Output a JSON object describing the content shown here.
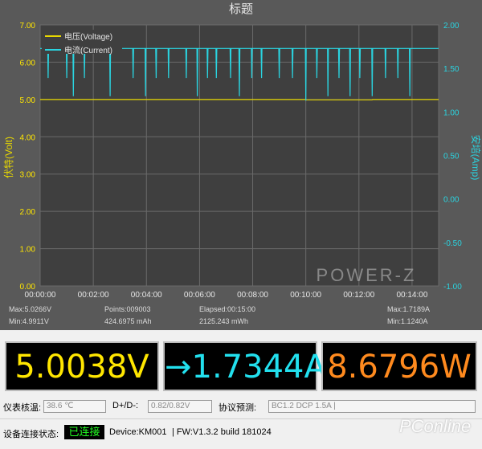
{
  "title": "标题",
  "chart_data": {
    "type": "line",
    "title": "标题",
    "xlabel": "",
    "ylabel_left": "伏特(Volt)",
    "ylabel_right": "安培(Amp)",
    "x_ticks": [
      "00:00:00",
      "00:02:00",
      "00:04:00",
      "00:06:00",
      "00:08:00",
      "00:10:00",
      "00:12:00",
      "00:14:00"
    ],
    "y_left_ticks": [
      "0.00",
      "1.00",
      "2.00",
      "3.00",
      "4.00",
      "5.00",
      "6.00",
      "7.00"
    ],
    "y_right_ticks": [
      "-1.00",
      "-0.50",
      "0.00",
      "0.50",
      "1.00",
      "1.50",
      "2.00"
    ],
    "xlim": [
      0,
      900
    ],
    "ylim_left": [
      0,
      7
    ],
    "ylim_right": [
      -1,
      2
    ],
    "grid": true,
    "legend_position": "top-left",
    "series": [
      {
        "name": "电压(Voltage)",
        "axis": "left",
        "color": "#e8d800",
        "x": [
          0,
          600,
          601,
          750,
          751,
          900
        ],
        "values": [
          5.0,
          5.0,
          4.99,
          4.99,
          5.0,
          5.0
        ]
      },
      {
        "name": "电流(Current)",
        "axis": "right",
        "color": "#2ad4e0",
        "baseline": 1.73,
        "x": [
          0,
          900
        ],
        "values": [
          1.73,
          1.73
        ],
        "dips": [
          {
            "t": 18,
            "v": 1.39
          },
          {
            "t": 60,
            "v": 1.39
          },
          {
            "t": 75,
            "v": 1.18
          },
          {
            "t": 100,
            "v": 1.39
          },
          {
            "t": 158,
            "v": 1.18
          },
          {
            "t": 210,
            "v": 1.39
          },
          {
            "t": 238,
            "v": 1.18
          },
          {
            "t": 262,
            "v": 1.39
          },
          {
            "t": 290,
            "v": 1.39
          },
          {
            "t": 330,
            "v": 1.39
          },
          {
            "t": 355,
            "v": 1.18
          },
          {
            "t": 378,
            "v": 1.39
          },
          {
            "t": 398,
            "v": 1.39
          },
          {
            "t": 430,
            "v": 1.39
          },
          {
            "t": 450,
            "v": 1.18
          },
          {
            "t": 478,
            "v": 1.39
          },
          {
            "t": 500,
            "v": 1.39
          },
          {
            "t": 540,
            "v": 1.39
          },
          {
            "t": 570,
            "v": 1.39
          },
          {
            "t": 600,
            "v": 1.13
          },
          {
            "t": 625,
            "v": 1.39
          },
          {
            "t": 650,
            "v": 1.18
          },
          {
            "t": 675,
            "v": 1.39
          },
          {
            "t": 700,
            "v": 1.18
          },
          {
            "t": 722,
            "v": 1.39
          },
          {
            "t": 750,
            "v": 1.18
          },
          {
            "t": 780,
            "v": 1.39
          },
          {
            "t": 808,
            "v": 1.39
          },
          {
            "t": 835,
            "v": 1.18
          }
        ]
      }
    ]
  },
  "watermark_chart": "POWER-Z",
  "watermark_corner": "PConline",
  "stats": {
    "max_v": "Max:5.0266V",
    "min_v": "Min:4.9911V",
    "points": "Points:009003",
    "mah": "424.6975 mAh",
    "elapsed": "Elapsed:00:15:00",
    "mwh": "2125.243 mWh",
    "max_a": "Max:1.7189A",
    "min_a": "Min:1.1240A"
  },
  "readouts": {
    "voltage": "5.0038V",
    "current": "→1.7344A",
    "power": "8.6796W",
    "voltage_color": "#ffe600",
    "current_color": "#22e0ee",
    "power_color": "#ff8a1e"
  },
  "info": {
    "temp_label": "仪表核温:",
    "temp_value": "38.6 ℃",
    "dpdm_label": "D+/D-:",
    "dpdm_value": "0.82/0.82V",
    "protocol_label": "协议预测:",
    "protocol_value": "BC1.2 DCP 1.5A |"
  },
  "status": {
    "label": "设备连接状态:",
    "connected": "已连接",
    "device": "Device:KM001",
    "firmware": "| FW:V1.3.2 build 181024"
  }
}
